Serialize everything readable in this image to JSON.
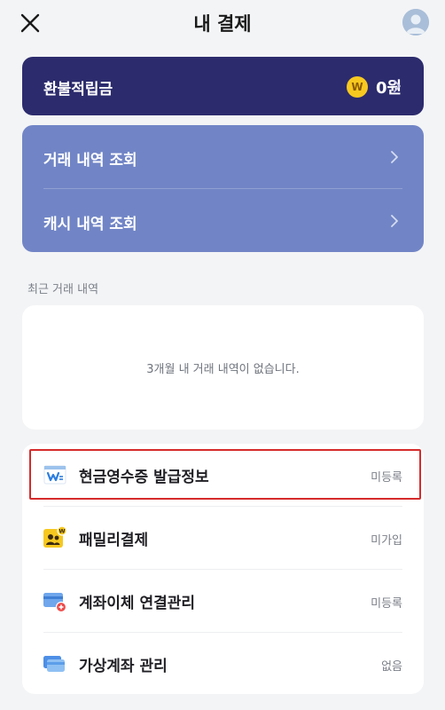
{
  "header": {
    "title": "내 결제"
  },
  "refund": {
    "label": "환불적립금",
    "coin_symbol": "W",
    "amount": "0원"
  },
  "history_links": [
    {
      "label": "거래 내역 조회"
    },
    {
      "label": "캐시 내역 조회"
    }
  ],
  "recent": {
    "section_label": "최근 거래 내역",
    "empty_message": "3개월 내 거래 내역이 없습니다."
  },
  "menu": [
    {
      "label": "현금영수증 발급정보",
      "status": "미등록",
      "icon": "cash-receipt-icon"
    },
    {
      "label": "패밀리결제",
      "status": "미가입",
      "icon": "family-payment-icon"
    },
    {
      "label": "계좌이체 연결관리",
      "status": "미등록",
      "icon": "bank-transfer-icon"
    },
    {
      "label": "가상계좌 관리",
      "status": "없음",
      "icon": "virtual-account-icon"
    }
  ],
  "colors": {
    "refund_card": "#2c2b6d",
    "history_card": "#7185c6",
    "coin": "#f7c920",
    "highlight": "#d62b2b",
    "background": "#f3f4f6"
  }
}
